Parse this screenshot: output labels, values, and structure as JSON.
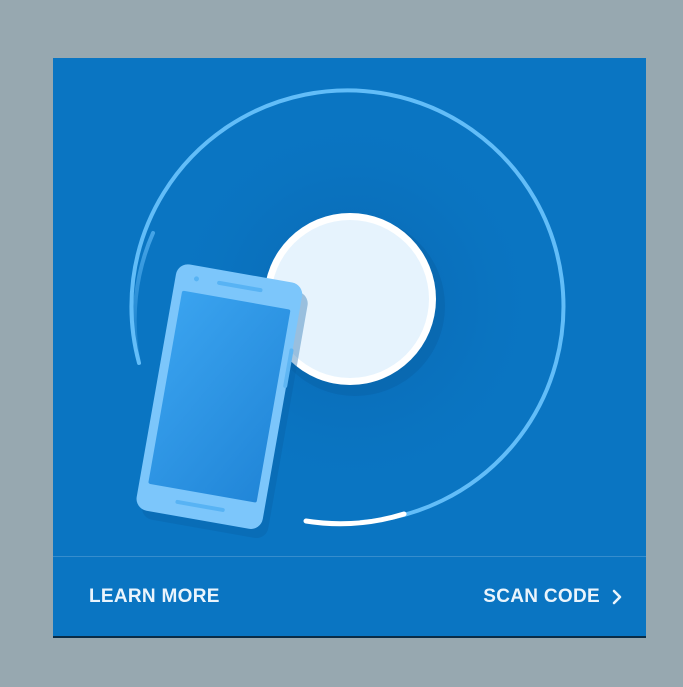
{
  "card": {
    "background_color": "#0a75c2",
    "illustration_icon": "phone-scan-illustration"
  },
  "actions": {
    "learn_more_label": "LEARN MORE",
    "scan_code_label": "SCAN CODE",
    "scan_code_icon": "chevron-right-icon"
  }
}
